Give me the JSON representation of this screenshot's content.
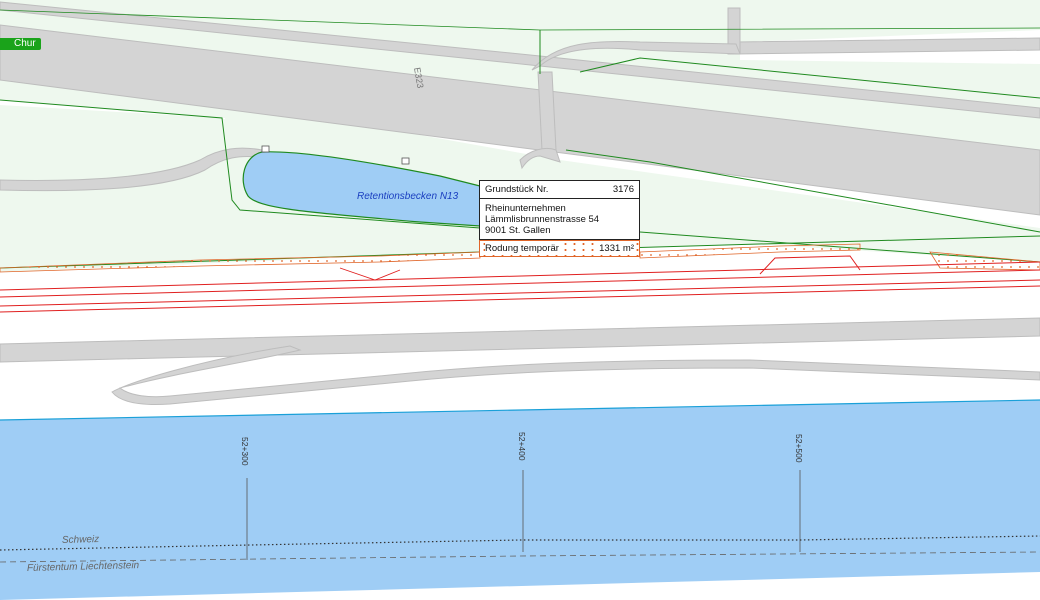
{
  "map": {
    "signpost": {
      "label": "Chur",
      "color": "#1aa31a"
    },
    "road_number": "E323",
    "pond": {
      "label": "Retentionsbecken N13",
      "color": "#9fcdf5",
      "label_color": "#1a3fc0"
    },
    "river_color": "#9fcdf5",
    "road_color": "#d4d4d4",
    "parcel_line_color": "#1f8a1f",
    "clearing_color": "#e0662a",
    "kilometer_markers": [
      "52+300",
      "52+400",
      "52+500"
    ],
    "border_labels": {
      "north": "Schweiz",
      "south": "Fürstentum Liechtenstein"
    }
  },
  "parcel_info": {
    "parcel_label": "Grundstück Nr.",
    "parcel_number": "3176",
    "owner_lines": [
      "Rheinunternehmen",
      "Lämmlisbrunnenstrasse 54",
      "9001 St. Gallen"
    ],
    "rodung_label": "Rodung temporär",
    "rodung_area": "1331 m²"
  }
}
